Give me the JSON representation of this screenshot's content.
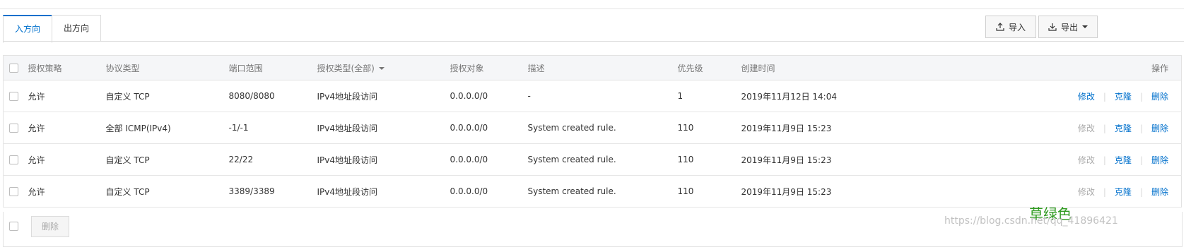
{
  "tabs": [
    {
      "label": "入方向",
      "active": true
    },
    {
      "label": "出方向",
      "active": false
    }
  ],
  "toolbar": {
    "import_label": "导入",
    "export_label": "导出",
    "import_icon": "upload-icon",
    "export_icon": "download-icon"
  },
  "table": {
    "headers": {
      "policy": "授权策略",
      "protocol": "协议类型",
      "port": "端口范围",
      "auth_type": "授权类型(全部)",
      "auth_object": "授权对象",
      "description": "描述",
      "priority": "优先级",
      "created": "创建时间",
      "actions": "操作"
    },
    "rows": [
      {
        "policy": "允许",
        "protocol": "自定义 TCP",
        "port": "8080/8080",
        "auth_type": "IPv4地址段访问",
        "auth_object": "0.0.0.0/0",
        "description": "-",
        "priority": "1",
        "created": "2019年11月12日 14:04",
        "edit": "修改",
        "edit_enabled": true,
        "clone": "克隆",
        "delete": "删除"
      },
      {
        "policy": "允许",
        "protocol": "全部 ICMP(IPv4)",
        "port": "-1/-1",
        "auth_type": "IPv4地址段访问",
        "auth_object": "0.0.0.0/0",
        "description": "System created rule.",
        "priority": "110",
        "created": "2019年11月9日 15:23",
        "edit": "修改",
        "edit_enabled": false,
        "clone": "克隆",
        "delete": "删除"
      },
      {
        "policy": "允许",
        "protocol": "自定义 TCP",
        "port": "22/22",
        "auth_type": "IPv4地址段访问",
        "auth_object": "0.0.0.0/0",
        "description": "System created rule.",
        "priority": "110",
        "created": "2019年11月9日 15:23",
        "edit": "修改",
        "edit_enabled": false,
        "clone": "克隆",
        "delete": "删除"
      },
      {
        "policy": "允许",
        "protocol": "自定义 TCP",
        "port": "3389/3389",
        "auth_type": "IPv4地址段访问",
        "auth_object": "0.0.0.0/0",
        "description": "System created rule.",
        "priority": "110",
        "created": "2019年11月9日 15:23",
        "edit": "修改",
        "edit_enabled": false,
        "clone": "克隆",
        "delete": "删除"
      }
    ]
  },
  "footer": {
    "delete_label": "删除"
  },
  "watermark": {
    "green_text": "草绿色",
    "url": "https://blog.csdn.net/qq_41896421"
  },
  "colors": {
    "accent": "#0070cc",
    "disabled": "#aaaaaa",
    "watermark_green": "#2e9a1f"
  }
}
